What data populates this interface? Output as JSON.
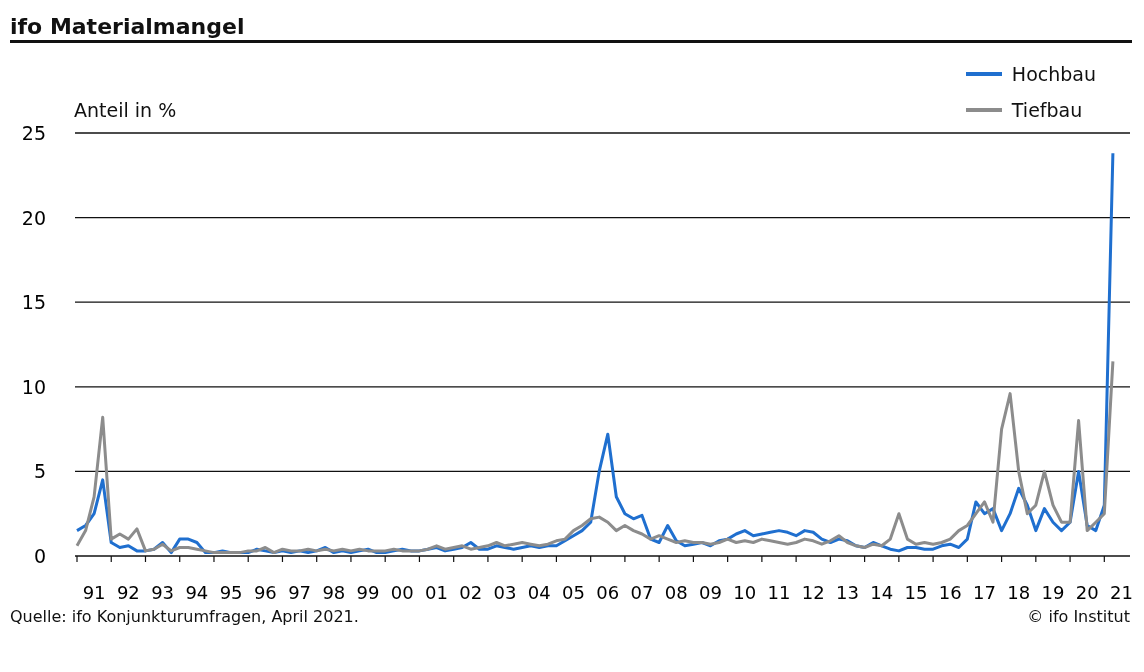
{
  "title": "ifo Materialmangel",
  "chart": {
    "chart_data": {
      "type": "line",
      "grid": true,
      "ylabel": "Anteil in %",
      "ylim": [
        0,
        25
      ],
      "yticks": [
        0,
        5,
        10,
        15,
        20,
        25
      ],
      "categories": [
        null,
        null,
        "91",
        null,
        null,
        null,
        "92",
        null,
        null,
        null,
        "93",
        null,
        null,
        null,
        "94",
        null,
        null,
        null,
        "95",
        null,
        null,
        null,
        "96",
        null,
        null,
        null,
        "97",
        null,
        null,
        null,
        "98",
        null,
        null,
        null,
        "99",
        null,
        null,
        null,
        "00",
        null,
        null,
        null,
        "01",
        null,
        null,
        null,
        "02",
        null,
        null,
        null,
        "03",
        null,
        null,
        null,
        "04",
        null,
        null,
        null,
        "05",
        null,
        null,
        null,
        "06",
        null,
        null,
        null,
        "07",
        null,
        null,
        null,
        "08",
        null,
        null,
        null,
        "09",
        null,
        null,
        null,
        "10",
        null,
        null,
        null,
        "11",
        null,
        null,
        null,
        "12",
        null,
        null,
        null,
        "13",
        null,
        null,
        null,
        "14",
        null,
        null,
        null,
        "15",
        null,
        null,
        null,
        "16",
        null,
        null,
        null,
        "17",
        null,
        null,
        null,
        "18",
        null,
        null,
        null,
        "19",
        null,
        null,
        null,
        "20",
        null,
        null,
        null,
        "21"
      ],
      "series": [
        {
          "name": "Hochbau",
          "color": "#1f6fcf",
          "values": [
            1.5,
            1.8,
            2.5,
            4.5,
            0.8,
            0.5,
            0.6,
            0.3,
            0.3,
            0.4,
            0.8,
            0.2,
            1.0,
            1.0,
            0.8,
            0.2,
            0.2,
            0.3,
            0.2,
            0.2,
            0.2,
            0.4,
            0.3,
            0.2,
            0.3,
            0.2,
            0.3,
            0.2,
            0.3,
            0.5,
            0.2,
            0.3,
            0.2,
            0.3,
            0.4,
            0.2,
            0.2,
            0.3,
            0.4,
            0.3,
            0.3,
            0.4,
            0.5,
            0.3,
            0.4,
            0.5,
            0.8,
            0.4,
            0.4,
            0.6,
            0.5,
            0.4,
            0.5,
            0.6,
            0.5,
            0.6,
            0.6,
            0.9,
            1.2,
            1.5,
            2.0,
            5.0,
            7.2,
            3.5,
            2.5,
            2.2,
            2.4,
            1.0,
            0.8,
            1.8,
            0.9,
            0.6,
            0.7,
            0.8,
            0.6,
            0.9,
            1.0,
            1.3,
            1.5,
            1.2,
            1.3,
            1.4,
            1.5,
            1.4,
            1.2,
            1.5,
            1.4,
            1.0,
            0.8,
            1.0,
            0.9,
            0.6,
            0.5,
            0.8,
            0.6,
            0.4,
            0.3,
            0.5,
            0.5,
            0.4,
            0.4,
            0.6,
            0.7,
            0.5,
            1.0,
            3.2,
            2.5,
            2.8,
            1.5,
            2.5,
            4.0,
            3.0,
            1.5,
            2.8,
            2.0,
            1.5,
            2.0,
            5.0,
            1.8,
            1.5,
            3.0,
            23.8,
            null
          ]
        },
        {
          "name": "Tiefbau",
          "color": "#8c8c8c",
          "values": [
            0.6,
            1.5,
            3.5,
            8.2,
            1.0,
            1.3,
            1.0,
            1.6,
            0.3,
            0.4,
            0.7,
            0.3,
            0.5,
            0.5,
            0.4,
            0.3,
            0.2,
            0.2,
            0.2,
            0.2,
            0.3,
            0.3,
            0.5,
            0.2,
            0.4,
            0.3,
            0.3,
            0.4,
            0.3,
            0.4,
            0.3,
            0.4,
            0.3,
            0.4,
            0.3,
            0.3,
            0.3,
            0.4,
            0.3,
            0.3,
            0.3,
            0.4,
            0.6,
            0.4,
            0.5,
            0.6,
            0.4,
            0.5,
            0.6,
            0.8,
            0.6,
            0.7,
            0.8,
            0.7,
            0.6,
            0.7,
            0.9,
            1.0,
            1.5,
            1.8,
            2.2,
            2.3,
            2.0,
            1.5,
            1.8,
            1.5,
            1.3,
            1.0,
            1.2,
            1.0,
            0.8,
            0.9,
            0.8,
            0.8,
            0.7,
            0.8,
            1.0,
            0.8,
            0.9,
            0.8,
            1.0,
            0.9,
            0.8,
            0.7,
            0.8,
            1.0,
            0.9,
            0.7,
            0.9,
            1.2,
            0.8,
            0.6,
            0.5,
            0.7,
            0.6,
            1.0,
            2.5,
            1.0,
            0.7,
            0.8,
            0.7,
            0.8,
            1.0,
            1.5,
            1.8,
            2.5,
            3.2,
            2.0,
            7.5,
            9.6,
            5.0,
            2.5,
            3.0,
            5.0,
            3.0,
            2.0,
            2.0,
            8.0,
            1.5,
            2.0,
            2.5,
            11.5,
            null
          ]
        }
      ]
    }
  },
  "footer": {
    "source": "Quelle: ifo Konjunkturumfragen, April 2021.",
    "copyright": "© ifo Institut"
  }
}
